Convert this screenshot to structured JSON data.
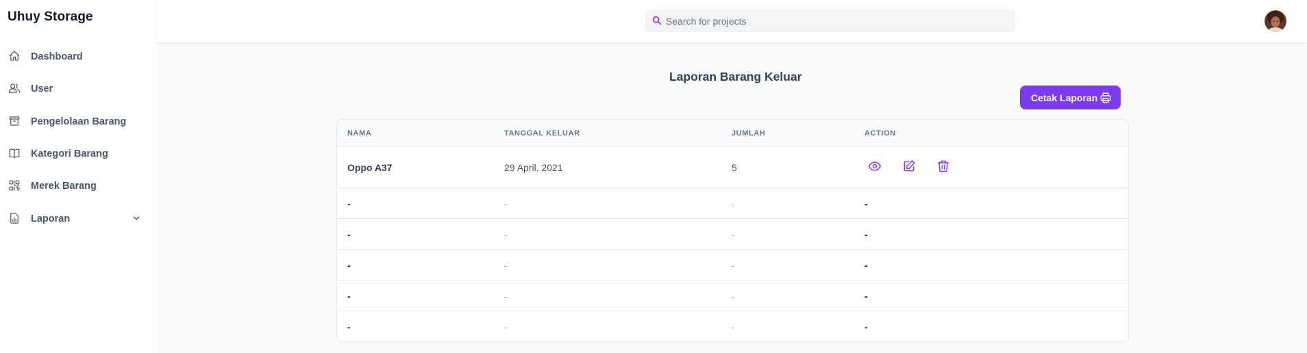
{
  "app": {
    "title": "Uhuy Storage"
  },
  "sidebar": {
    "items": [
      {
        "label": "Dashboard",
        "icon": "home-icon"
      },
      {
        "label": "User",
        "icon": "users-icon"
      },
      {
        "label": "Pengelolaan Barang",
        "icon": "archive-icon"
      },
      {
        "label": "Kategori Barang",
        "icon": "book-icon"
      },
      {
        "label": "Merek Barang",
        "icon": "qr-code-icon"
      },
      {
        "label": "Laporan",
        "icon": "document-report-icon",
        "expandable": true
      }
    ]
  },
  "header": {
    "search": {
      "placeholder": "Search for projects",
      "value": ""
    }
  },
  "main": {
    "title": "Laporan Barang Keluar",
    "print_button": "Cetak Laporan",
    "table": {
      "columns": [
        "Nama",
        "Tanggal Keluar",
        "Jumlah",
        "Action"
      ],
      "rows": [
        {
          "nama": "Oppo A37",
          "tanggal": "29 April, 2021",
          "jumlah": "5",
          "action": "icons"
        },
        {
          "nama": "-",
          "tanggal": "-",
          "jumlah": "-",
          "action": "-"
        },
        {
          "nama": "-",
          "tanggal": "-",
          "jumlah": "-",
          "action": "-"
        },
        {
          "nama": "-",
          "tanggal": "-",
          "jumlah": "-",
          "action": "-"
        },
        {
          "nama": "-",
          "tanggal": "-",
          "jumlah": "-",
          "action": "-"
        },
        {
          "nama": "-",
          "tanggal": "-",
          "jumlah": "-",
          "action": "-"
        }
      ]
    }
  },
  "colors": {
    "accent": "#7e3af2",
    "text_muted": "#6b7280",
    "background": "#f9fafb"
  }
}
